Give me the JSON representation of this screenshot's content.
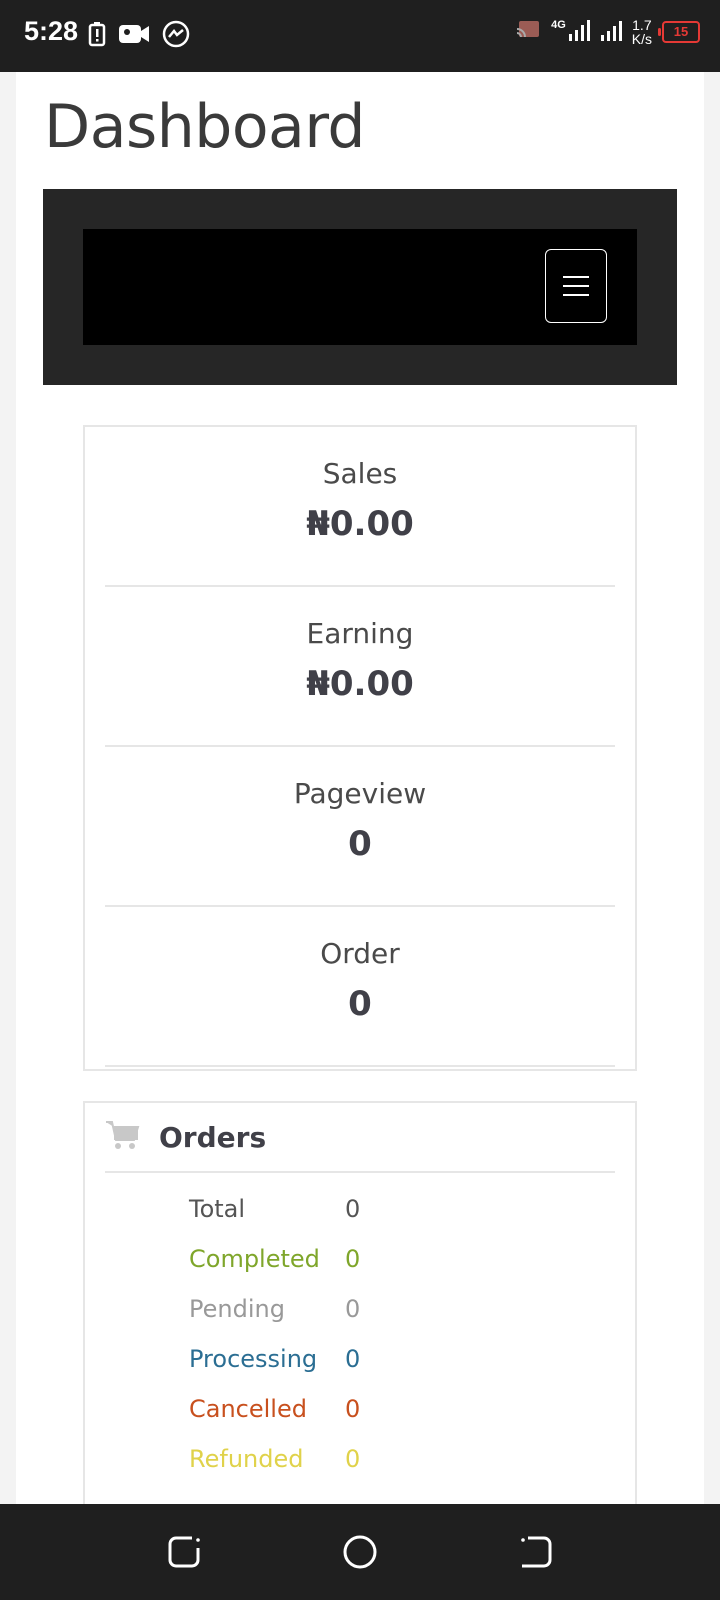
{
  "status_bar": {
    "time": "5:28",
    "network": "4G",
    "speed_value": "1.7",
    "speed_unit": "K/s",
    "battery": "15"
  },
  "page": {
    "title": "Dashboard"
  },
  "stats": [
    {
      "label": "Sales",
      "value": "₦0.00"
    },
    {
      "label": "Earning",
      "value": "₦0.00"
    },
    {
      "label": "Pageview",
      "value": "0"
    },
    {
      "label": "Order",
      "value": "0"
    }
  ],
  "orders": {
    "title": "Orders",
    "rows": [
      {
        "label": "Total",
        "value": "0",
        "color": "#555555"
      },
      {
        "label": "Completed",
        "value": "0",
        "color": "#7fa62b"
      },
      {
        "label": "Pending",
        "value": "0",
        "color": "#999999"
      },
      {
        "label": "Processing",
        "value": "0",
        "color": "#2b6e93"
      },
      {
        "label": "Cancelled",
        "value": "0",
        "color": "#c8501e"
      },
      {
        "label": "Refunded",
        "value": "0",
        "color": "#e0d24a"
      }
    ]
  },
  "icons": {
    "menu": "hamburger-menu-icon",
    "cart": "cart-icon",
    "nav_back": "back-icon",
    "nav_home": "home-icon",
    "nav_recent": "recent-apps-icon"
  }
}
